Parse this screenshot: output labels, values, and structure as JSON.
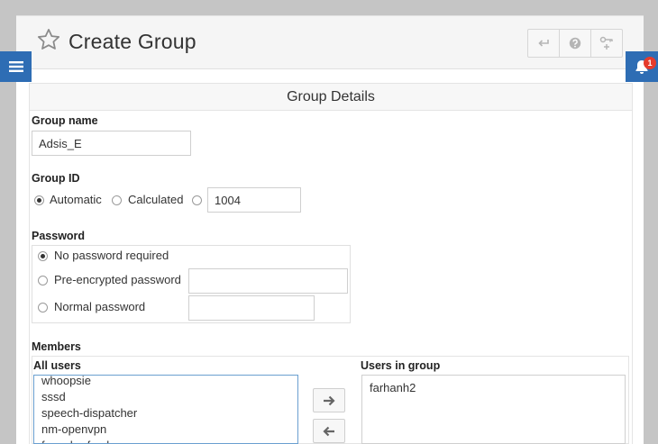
{
  "header": {
    "title": "Create Group",
    "actions": [
      {
        "name": "back",
        "icon": "return-arrow-icon"
      },
      {
        "name": "help",
        "icon": "question-circle-icon"
      },
      {
        "name": "configure",
        "icon": "key-plus-icon"
      }
    ]
  },
  "nav": {
    "menu_icon": "hamburger-menu-icon",
    "notifications_icon": "bell-icon",
    "notification_count": "1"
  },
  "section": {
    "title": "Group Details"
  },
  "group_name": {
    "label": "Group name",
    "value": "Adsis_E"
  },
  "group_id": {
    "label": "Group ID",
    "options": [
      "Automatic",
      "Calculated"
    ],
    "selected": "Automatic",
    "value": "1004"
  },
  "password": {
    "label": "Password",
    "options": [
      "No password required",
      "Pre-encrypted password",
      "Normal password"
    ],
    "selected": "No password required",
    "pre_encrypted_value": "",
    "normal_value": ""
  },
  "members": {
    "label": "Members",
    "all_users_label": "All users",
    "all_users": [
      "whoopsie",
      "sssd",
      "speech-dispatcher",
      "nm-openvpn",
      "fwupd-refresh"
    ],
    "users_in_group_label": "Users in group",
    "users_in_group": [
      "farhanh2"
    ],
    "add_icon": "arrow-right-icon",
    "remove_icon": "arrow-left-icon"
  },
  "colors": {
    "accent": "#2e6db4",
    "badge": "#e53b2c",
    "header_bg": "#f5f5f5",
    "outer_bg": "#c5c5c5"
  }
}
